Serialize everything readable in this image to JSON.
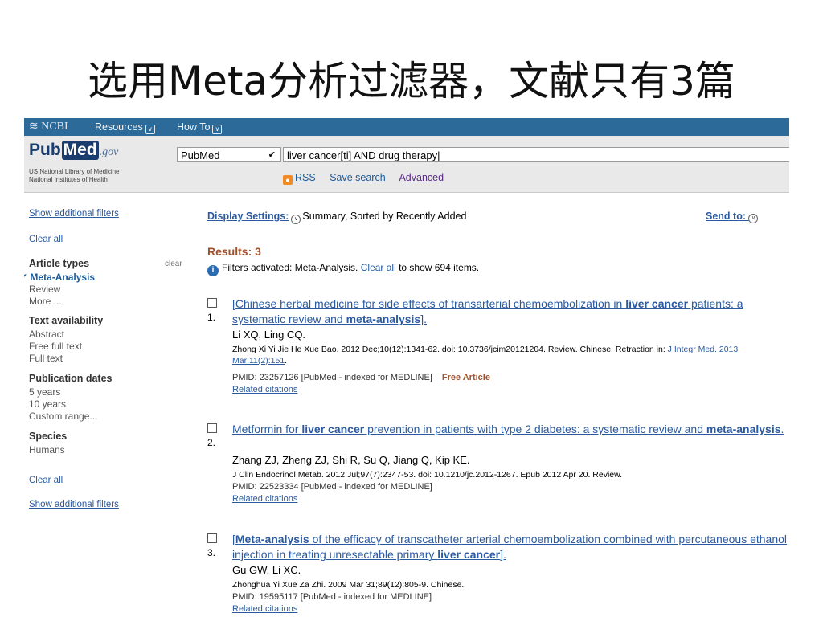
{
  "slide": {
    "title": "选用Meta分析过滤器，文献只有3篇"
  },
  "ncbi": {
    "logo": "NCBI",
    "resources": "Resources",
    "howto": "How To"
  },
  "search": {
    "logo_pub": "Pub",
    "logo_med": "Med",
    "logo_gov": ".gov",
    "sub1": "US National Library of Medicine",
    "sub2": "National Institutes of Health",
    "db": "PubMed",
    "query": "liver cancer[ti] AND drug therapy",
    "rss": "RSS",
    "save": "Save search",
    "advanced": "Advanced"
  },
  "sidebar": {
    "show_filters": "Show additional filters",
    "clear_all": "Clear all",
    "clear": "clear",
    "article_types": "Article types",
    "meta": "Meta-Analysis",
    "review": "Review",
    "more": "More ...",
    "text_avail": "Text availability",
    "abstract": "Abstract",
    "free_full": "Free full text",
    "full": "Full text",
    "pub_dates": "Publication dates",
    "y5": "5 years",
    "y10": "10 years",
    "custom": "Custom range...",
    "species": "Species",
    "humans": "Humans"
  },
  "main": {
    "display_settings": "Display Settings:",
    "summary": "Summary, Sorted by Recently Added",
    "send_to": "Send to:",
    "results": "Results: 3",
    "filters_pre": "Filters activated: Meta-Analysis.",
    "filters_link": "Clear all",
    "filters_post": "to show 694 items."
  },
  "results": [
    {
      "num": "1.",
      "title_a": "[Chinese herbal medicine for side effects of transarterial chemoembolization in ",
      "title_b": "liver cancer",
      "title_c": " patients: a systematic review and ",
      "title_d": "meta-analysis",
      "title_e": "].",
      "authors": "Li XQ, Ling CQ.",
      "journal": "Zhong Xi Yi Jie He Xue Bao. 2012 Dec;10(12):1341-62. doi: 10.3736/jcim20121204. Review. Chinese. Retraction in: ",
      "journal_link": "J Integr Med. 2013 Mar;11(2):151",
      "pmid": "PMID: 23257126 [PubMed - indexed for MEDLINE]",
      "free": "Free Article",
      "related": "Related citations"
    },
    {
      "num": "2.",
      "title_a": "Metformin for ",
      "title_b": "liver cancer",
      "title_c": " prevention in patients with type 2 diabetes: a systematic review and ",
      "title_d": "meta-analysis",
      "title_e": ".",
      "authors": "Zhang ZJ, Zheng ZJ, Shi R, Su Q, Jiang Q, Kip KE.",
      "journal": "J Clin Endocrinol Metab. 2012 Jul;97(7):2347-53. doi: 10.1210/jc.2012-1267. Epub 2012 Apr 20. Review.",
      "pmid": "PMID: 22523334 [PubMed - indexed for MEDLINE]",
      "related": "Related citations"
    },
    {
      "num": "3.",
      "title_a": "[",
      "title_b": "Meta-analysis",
      "title_c": " of the efficacy of transcatheter arterial chemoembolization combined with percutaneous ethanol injection in treating unresectable primary ",
      "title_d": "liver cancer",
      "title_e": "].",
      "authors": "Gu GW, Li XC.",
      "journal": "Zhonghua Yi Xue Za Zhi. 2009 Mar 31;89(12):805-9. Chinese.",
      "pmid": "PMID: 19595117 [PubMed - indexed for MEDLINE]",
      "related": "Related citations"
    }
  ]
}
